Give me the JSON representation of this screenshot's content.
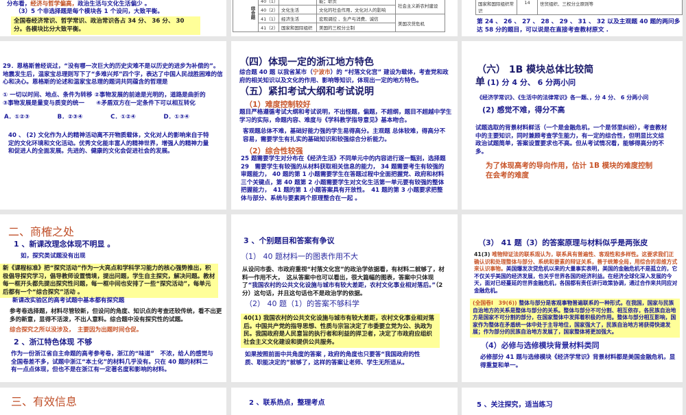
{
  "s1": {
    "line1_a": "分布看，",
    "line1_b": "经济与哲学偏高，",
    "line1_c": "政治生活与文化生活偏少 。",
    "line2": "（3）5 个非选择题是每个模块各 1 个设问，大致平衡。",
    "box": "全国卷经济常识、哲学常识、政治常识各占 34 分、 36 分、 30 分。各模块比分大致平衡。"
  },
  "s2": {
    "side": "综合题",
    "rows": [
      {
        "q": "40（1）",
        "m": "",
        "c": "能；职责",
        "mat": "社会主义新农村建设"
      },
      {
        "q": "40（2）",
        "m": "文化生活",
        "c": "文化的社会作用，文化对人的影响",
        "mat": ""
      },
      {
        "q": "41（1）",
        "m": "经济生活",
        "c": "宏观调控 、生产与消费、诚信",
        "mat": "美国次贷危机"
      },
      {
        "q": "41（2）",
        "m": "国家和国际组织",
        "c": "美国的三权分立制",
        "mat": ""
      }
    ]
  },
  "s3": {
    "row": {
      "name": "国家和国际组织常识",
      "score": "14",
      "content": "世贸组织、三权分立原则等"
    },
    "text": "第 24 、 26 、 27 、 28 、 29 、 31 、 32 以及主观题 40 题的两问多达 58 分的题目，可以说是在直接考查教材原文 ."
  },
  "s4": {
    "q": "29．恩格斯曾经说过，“没有哪一次巨大的历史灾难不是以历史的进步为补偿的”。地震发生后，温家宝总理则写下了“多难兴邦”四个字，表达了中国人民战胜困难的信心和决心。恩格斯的论述和温家宝总理的题词共同蕴含的哲理是",
    "opts": "① 一切以时间、地点、条件为转移 ②事物发展的前途是光明的，道路是曲折的　　　③事物发展是量变与质变的统一　　④矛盾双方在一定条件下可以相互转化",
    "answers": [
      "A．①②③",
      "B．②③④",
      "C．①②④",
      "D．①③④"
    ],
    "q40": "40 、 (2) 文化作为人的精神活动离不开物质载体，文化对人的影响来自于特定的文化环境和文化活动。优秀文化能丰富人的精神世界，增强人的精神力量和促进人的全面发展。先进的、健康的文化会促进社会的发展。"
  },
  "s5": {
    "h4": "（四）体现一定的浙江地方特色",
    "p4a": "综合题 40 题 以我省某市（",
    "p4city": "宁波市",
    "p4b": "）的 “村落文化宫” 建设为载体，考查党和政府的相关知识以及文化的作用、影响等知识，体现出一定的地方特色。",
    "h5": "（五）紧扣考试大纲和考试说明",
    "sub1": "（1）难度控制较好",
    "p1": "题目严格遵循考试大纲和考试说明，不出怪题，偏题，不超纲，题目不超越中学生学习的实际，命题内容、难度与《学科教学指导意见》基本吻合。",
    "p2": "客观题总体不难，基础好能力强的学生易得高分。主观题 总体较难，得高分不容易，需要学生有扎实的基础知识和较强综合分析能力。",
    "sub2": "（2）综合性较强",
    "p3": "25 题需要学生对分布在《经济生活》不同单元中的内容进行逐一甄别，选择题 29　需要学生有较强的从材料获取相关信息的能力， 34 题需要考生有较强的审题能力， 40 题的第 1 小题需要学生在答题过程中全面把握党、政府和材料三个关键点，第 40 题第 2 小题需要学生对文化生活第一单元要有较强的整体把握能力，　41 题的第 1 小题答案具有开放性。　41 题的第 3 小题要求把整体与部分、系统与要素两个原理整合在一起 。"
  },
  "s6": {
    "h6a": "（六） 1B 模块总体比较简",
    "h6b": "单",
    "sub1": "(1) 分 4 分、 6 分两小问",
    "p1": "《经济学常识》、《生活中的法律常识》各一题、，分 4 分、 6 分两小问",
    "sub2": "(2) 感觉不难，得分不高",
    "p2": "试题选取的背景材料鲜活（一个是金融危机，一个是邻里纠纷），考查教材中的主要知识，同时兼顾考查学生能力，有一定的综合性，但明显比文综政治试题简单，答案设置要求也不高。但从考试情况看，能够得高分的不多。",
    "p3": "为了体现高考的导向作用，估计 1B 模块的难度控制在会考的难度"
  },
  "s7": {
    "title": "二、商榷之处",
    "h1": "1 、新课改理念体现不明显 。",
    "eg": "如，探究类试题没有出现",
    "box": "新《课程标准》把“探究活动”作为一大亮点和学科学习能力的核心强势推出，积极倡导探究学习，倡导教师设置情境，提出问题，学生自主探究，解决问题。教材每一框开头都先提出探究性问题，每一框中间也安排了一些“探究活动”，每单元后都有一个“综合探究”活动 。",
    "p1": "新课改实验区的高考试题中基本都有探究题",
    "p2": "参考卷选择题，材料尽管较新，但设问的角度、知识点的考查还较传统，看不出更多的新意，显得不活泼，不出人意料。综合题中没有探究性的试题。",
    "p3": "综合探究之所以没涉及，　主要因为出题时间仓促。",
    "h2": "2 、浙江特色体现 不够",
    "p4": "作为一份浙江省自主命题的高考参考卷，浙江的“味道”　不浓，给人的感觉与全国卷差不多，试题中浙江“本土化”的材料几乎没有。只在 40 题的材料二有一点点体现，但也不是在浙江有一定著名度和影响的材料。"
  },
  "s8": {
    "h": "3 、个别题目和答案有争议",
    "sub1": "（1） 40 题材料一的图表作用不大",
    "p1a": "从设问市委、市政府重视“村落文化宫”的政治学依据看，有材料二就够了，材料一作用不大，　这从答案中也可以看出，很大篇幅的图表，答案中只体现了",
    "p1q": "“我国农村的公共文化设施与城市有较大差距，农村文化事业相对落后。”",
    "p1b": "（2 分）这句话，并且这句话也不是政治学的依据。",
    "sub2": "（2） 40 题（1）的答案不够科学",
    "box": "40(1) 我国农村的公共文化设施与城市有较大差距，农村文化事业相对落后。中国共产党的指导思想、性质与宗旨决定了市委要立党为公、执政为民。我国政府是人民意旨的执行者和利益的捍卫者，决定了市政府应组织社会主义文化建设和提供公共服务。",
    "p2": "如果按照前面中共角度的答案 , 政府的角度也只要答“我国政府的性质、职能决定的”就够了，这样的答案让老师、学生无所适从。"
  },
  "s9": {
    "h": "（3） 41 题（3）的答案原理与材料似乎是两张皮",
    "p1lead": "41(3) ",
    "p1red": "唯物辩证法的联系观认为，联系具有普遍性、客观性和多样性。这要求我们正确认识和处理整体与部分、系统和要素的辩证关系，善于统筹全局，用综合的思维方式来认识事物。",
    "p1blue": "美国爆发次贷危机以来的大量事实表明，美国的金融危机不是孤立的，它不仅关乎美国的经济发展，也关乎世界各国的经济利益。在经济全球化深入发展的今天，面对已经蔓延的世界金融危机，各国都有责任讲行政策协调，通过合作来共同应对金融危机。",
    "boxlead": "(全国卷Ⅰ　39(6))",
    "box": " 整体与部分是客观事物普遍联系的一种形式。在我国，国家与民族自治地方的关系是整体与部分的关系。整体与部分不可分割、相互依存，各民族自治地方是国家不可分割的部分，在国家整体中发挥着积极的作用。整体与部分相互影响，国家作为整体在矛盾统一体中处于主导地位，国家强大了，民族自治地方将获得快速发展；作为部分的民族自治地方发展了，国家整体将更加强大。",
    "h4": "（4）必修与选修模块背景材料类同",
    "p4": "必修部分 41 题与选修模块《经济学常识》背景材料都是美国金融危机，显得重复和单一。"
  },
  "s10": {
    "title": "三、有效信息"
  },
  "s11": {
    "title": "2 、联系热点，整理考点"
  },
  "s12": {
    "title": "5 、关注探究，适当练习"
  }
}
